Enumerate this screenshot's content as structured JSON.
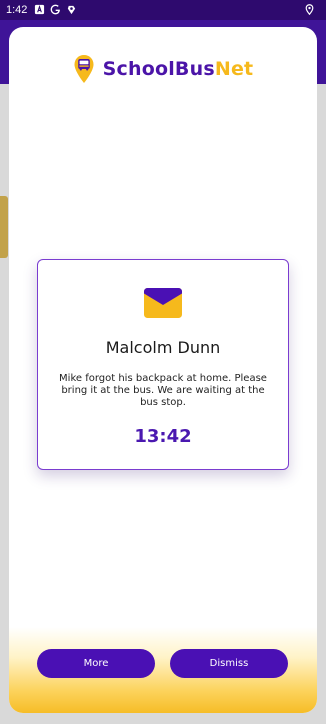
{
  "status_bar": {
    "time": "1:42",
    "icons": [
      "notification-a-icon",
      "google-icon",
      "signal-app-icon"
    ],
    "right_icon": "location-icon"
  },
  "brand": {
    "name_part1": "SchoolBus",
    "name_part2": "Net",
    "logo_icon": "bus-pin-logo-icon"
  },
  "notification": {
    "icon": "envelope-icon",
    "sender": "Malcolm Dunn",
    "message": "Mike forgot his backpack at home. Please bring it at the bus. We are waiting at the bus stop.",
    "time": "13:42"
  },
  "actions": {
    "more_label": "More",
    "dismiss_label": "Dismiss"
  },
  "colors": {
    "primary": "#4a10b4",
    "accent": "#f6b91c",
    "status_bar": "#2e0a6e"
  }
}
